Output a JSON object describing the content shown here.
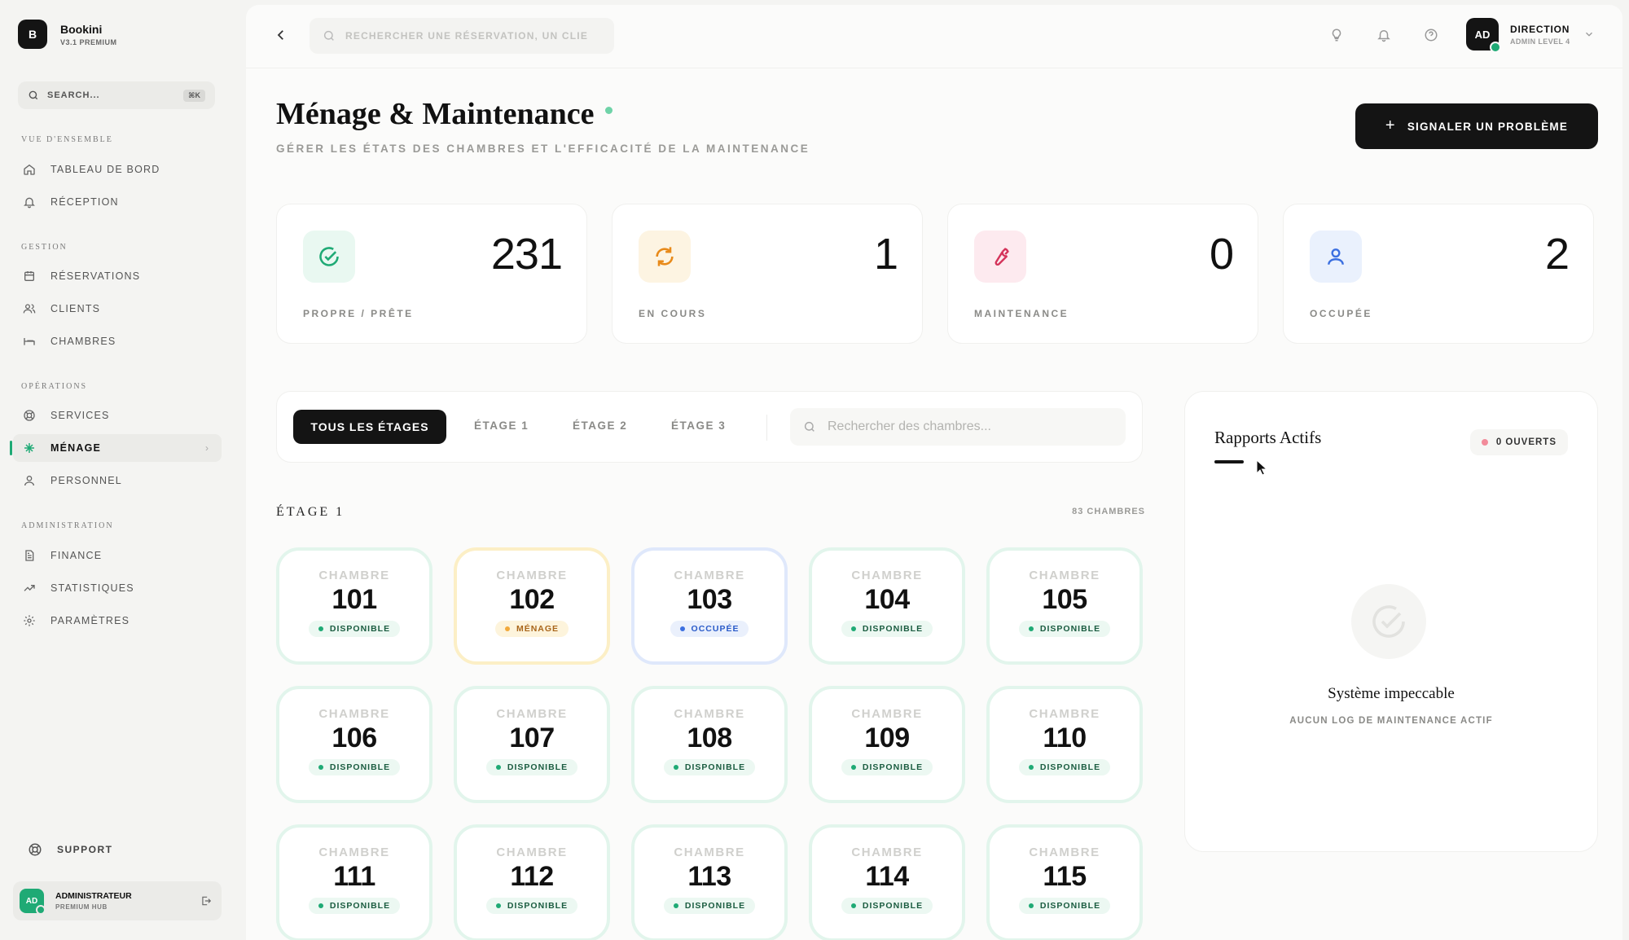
{
  "brand": {
    "logo_letter": "B",
    "name": "Bookini",
    "version": "V3.1 PREMIUM"
  },
  "sidebar": {
    "search_placeholder": "SEARCH...",
    "shortcut": "⌘K",
    "sections": {
      "overview": "VUE D'ENSEMBLE",
      "gestion": "GESTION",
      "operations": "OPÉRATIONS",
      "administration": "ADMINISTRATION"
    },
    "items": {
      "dashboard": "TABLEAU DE BORD",
      "reception": "RÉCEPTION",
      "reservations": "RÉSERVATIONS",
      "clients": "CLIENTS",
      "chambres": "CHAMBRES",
      "services": "SERVICES",
      "menage": "MÉNAGE",
      "personnel": "PERSONNEL",
      "finance": "FINANCE",
      "statistiques": "STATISTIQUES",
      "parametres": "PARAMÈTRES"
    },
    "support": "SUPPORT",
    "user": {
      "initials": "AD",
      "name": "ADMINISTRATEUR",
      "role": "PREMIUM HUB"
    }
  },
  "topbar": {
    "search_placeholder": "RECHERCHER UNE RÉSERVATION, UN CLIE",
    "account": {
      "initials": "AD",
      "name": "DIRECTION",
      "role": "ADMIN LEVEL 4"
    }
  },
  "page": {
    "title": "Ménage & Maintenance",
    "subtitle": "GÉRER LES ÉTATS DES CHAMBRES ET L'EFFICACITÉ DE LA MAINTENANCE",
    "report_button": "SIGNALER UN PROBLÈME"
  },
  "stats": [
    {
      "label": "PROPRE / PRÊTE",
      "value": "231",
      "icon": "check-circle-icon",
      "color": "#1faa75",
      "bg": "#e9f8f1"
    },
    {
      "label": "EN COURS",
      "value": "1",
      "icon": "refresh-icon",
      "color": "#e88a1a",
      "bg": "#fdf4e2"
    },
    {
      "label": "MAINTENANCE",
      "value": "0",
      "icon": "wrench-icon",
      "color": "#d4335a",
      "bg": "#fdeaef"
    },
    {
      "label": "OCCUPÉE",
      "value": "2",
      "icon": "user-icon",
      "color": "#3b6fe0",
      "bg": "#eaf1fd"
    }
  ],
  "filters": {
    "tabs": [
      "TOUS LES ÉTAGES",
      "ÉTAGE 1",
      "ÉTAGE 2",
      "ÉTAGE 3"
    ],
    "room_search_placeholder": "Rechercher des chambres..."
  },
  "floor": {
    "title": "ÉTAGE 1",
    "count": "83 CHAMBRES",
    "room_label": "CHAMBRE",
    "rooms": [
      {
        "number": "101",
        "status": "DISPONIBLE",
        "state": "disponible"
      },
      {
        "number": "102",
        "status": "MÉNAGE",
        "state": "menage"
      },
      {
        "number": "103",
        "status": "OCCUPÉE",
        "state": "occupee"
      },
      {
        "number": "104",
        "status": "DISPONIBLE",
        "state": "disponible"
      },
      {
        "number": "105",
        "status": "DISPONIBLE",
        "state": "disponible"
      },
      {
        "number": "106",
        "status": "DISPONIBLE",
        "state": "disponible"
      },
      {
        "number": "107",
        "status": "DISPONIBLE",
        "state": "disponible"
      },
      {
        "number": "108",
        "status": "DISPONIBLE",
        "state": "disponible"
      },
      {
        "number": "109",
        "status": "DISPONIBLE",
        "state": "disponible"
      },
      {
        "number": "110",
        "status": "DISPONIBLE",
        "state": "disponible"
      },
      {
        "number": "111",
        "status": "DISPONIBLE",
        "state": "disponible"
      },
      {
        "number": "112",
        "status": "DISPONIBLE",
        "state": "disponible"
      },
      {
        "number": "113",
        "status": "DISPONIBLE",
        "state": "disponible"
      },
      {
        "number": "114",
        "status": "DISPONIBLE",
        "state": "disponible"
      },
      {
        "number": "115",
        "status": "DISPONIBLE",
        "state": "disponible"
      }
    ]
  },
  "reports": {
    "title": "Rapports Actifs",
    "open_count": "0 OUVERTS",
    "empty_title": "Système impeccable",
    "empty_sub": "AUCUN LOG DE MAINTENANCE ACTIF"
  },
  "colors": {
    "accent": "#1faa75",
    "dark": "#141414"
  }
}
